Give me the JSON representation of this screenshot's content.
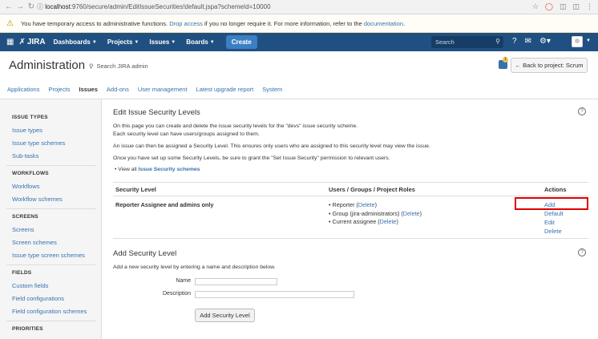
{
  "browser": {
    "url_host": "localhost",
    "url_rest": ":9760/secure/admin/EditIssueSecurities!default.jspa?schemeId=10000"
  },
  "warning": {
    "text_before": "You have temporary access to administrative functions.",
    "drop_link": "Drop access",
    "text_middle": "if you no longer require it. For more information, refer to the",
    "doc_link": "documentation",
    "text_end": "."
  },
  "header": {
    "logo": "JIRA",
    "menus": [
      "Dashboards",
      "Projects",
      "Issues",
      "Boards"
    ],
    "create": "Create",
    "search_placeholder": "Search"
  },
  "admin": {
    "title": "Administration",
    "search": "Search JIRA admin",
    "notif_count": "1",
    "back_button": "← Back to project: Scrum",
    "tabs": [
      "Applications",
      "Projects",
      "Issues",
      "Add-ons",
      "User management",
      "Latest upgrade report",
      "System"
    ]
  },
  "sidebar": {
    "issue_types": {
      "heading": "ISSUE TYPES",
      "links": [
        "Issue types",
        "Issue type schemes",
        "Sub-tasks"
      ]
    },
    "workflows": {
      "heading": "WORKFLOWS",
      "links": [
        "Workflows",
        "Workflow schemes"
      ]
    },
    "screens": {
      "heading": "SCREENS",
      "links": [
        "Screens",
        "Screen schemes",
        "Issue type screen schemes"
      ]
    },
    "fields": {
      "heading": "FIELDS",
      "links": [
        "Custom fields",
        "Field configurations",
        "Field configuration schemes"
      ]
    },
    "priorities": {
      "heading": "PRIORITIES"
    }
  },
  "main": {
    "title": "Edit Issue Security Levels",
    "intro1": "On this page you can create and delete the issue security levels for the \"devs\" issue security scheme.",
    "intro2": "Each security level can have users/groups assigned to them.",
    "intro3": "An issue can then be assigned a Security Level. This ensures only users who are assigned to this security level may view the issue.",
    "intro4": "Once you have set up some Security Levels, be sure to grant the \"Set Issue Security\" permission to relevant users.",
    "view_all_prefix": "View all",
    "view_all_link": "Issue Security schemes",
    "table": {
      "headers": [
        "Security Level",
        "Users / Groups / Project Roles",
        "Actions"
      ],
      "row": {
        "level": "Reporter Assignee and admins only",
        "roles": [
          {
            "name": "Reporter",
            "open": " (",
            "link": "Delete",
            "close": ")"
          },
          {
            "name": "Group (jira-administrators)",
            "open": " (",
            "link": "Delete",
            "close": ")"
          },
          {
            "name": "Current assignee",
            "open": " (",
            "link": "Delete",
            "close": ")"
          }
        ],
        "actions": [
          "Add",
          "Default",
          "Edit",
          "Delete"
        ]
      }
    },
    "add_section": {
      "title": "Add Security Level",
      "desc": "Add a new security level by entering a name and description below.",
      "name_label": "Name",
      "desc_label": "Description",
      "submit": "Add Security Level"
    }
  },
  "colors": {
    "header_bg": "#205081",
    "link": "#3572b0",
    "highlight": "#e10000"
  }
}
